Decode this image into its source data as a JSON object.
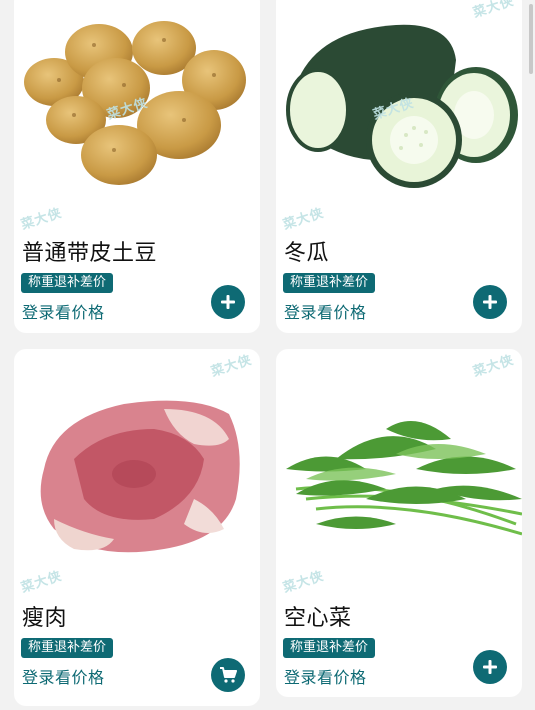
{
  "watermark": "菜大侠",
  "products": [
    {
      "name": "普通带皮土豆",
      "tag": "称重退补差价",
      "price_text": "登录看价格",
      "action_icon": "plus-icon"
    },
    {
      "name": "冬瓜",
      "tag": "称重退补差价",
      "price_text": "登录看价格",
      "action_icon": "plus-icon"
    },
    {
      "name": "瘦肉",
      "tag": "称重退补差价",
      "price_text": "登录看价格",
      "action_icon": "cart-icon"
    },
    {
      "name": "空心菜",
      "tag": "称重退补差价",
      "price_text": "登录看价格",
      "action_icon": "plus-icon"
    }
  ],
  "colors": {
    "accent": "#0e6a74",
    "tag_bg": "#0e6a74",
    "background": "#f2f2f2"
  }
}
